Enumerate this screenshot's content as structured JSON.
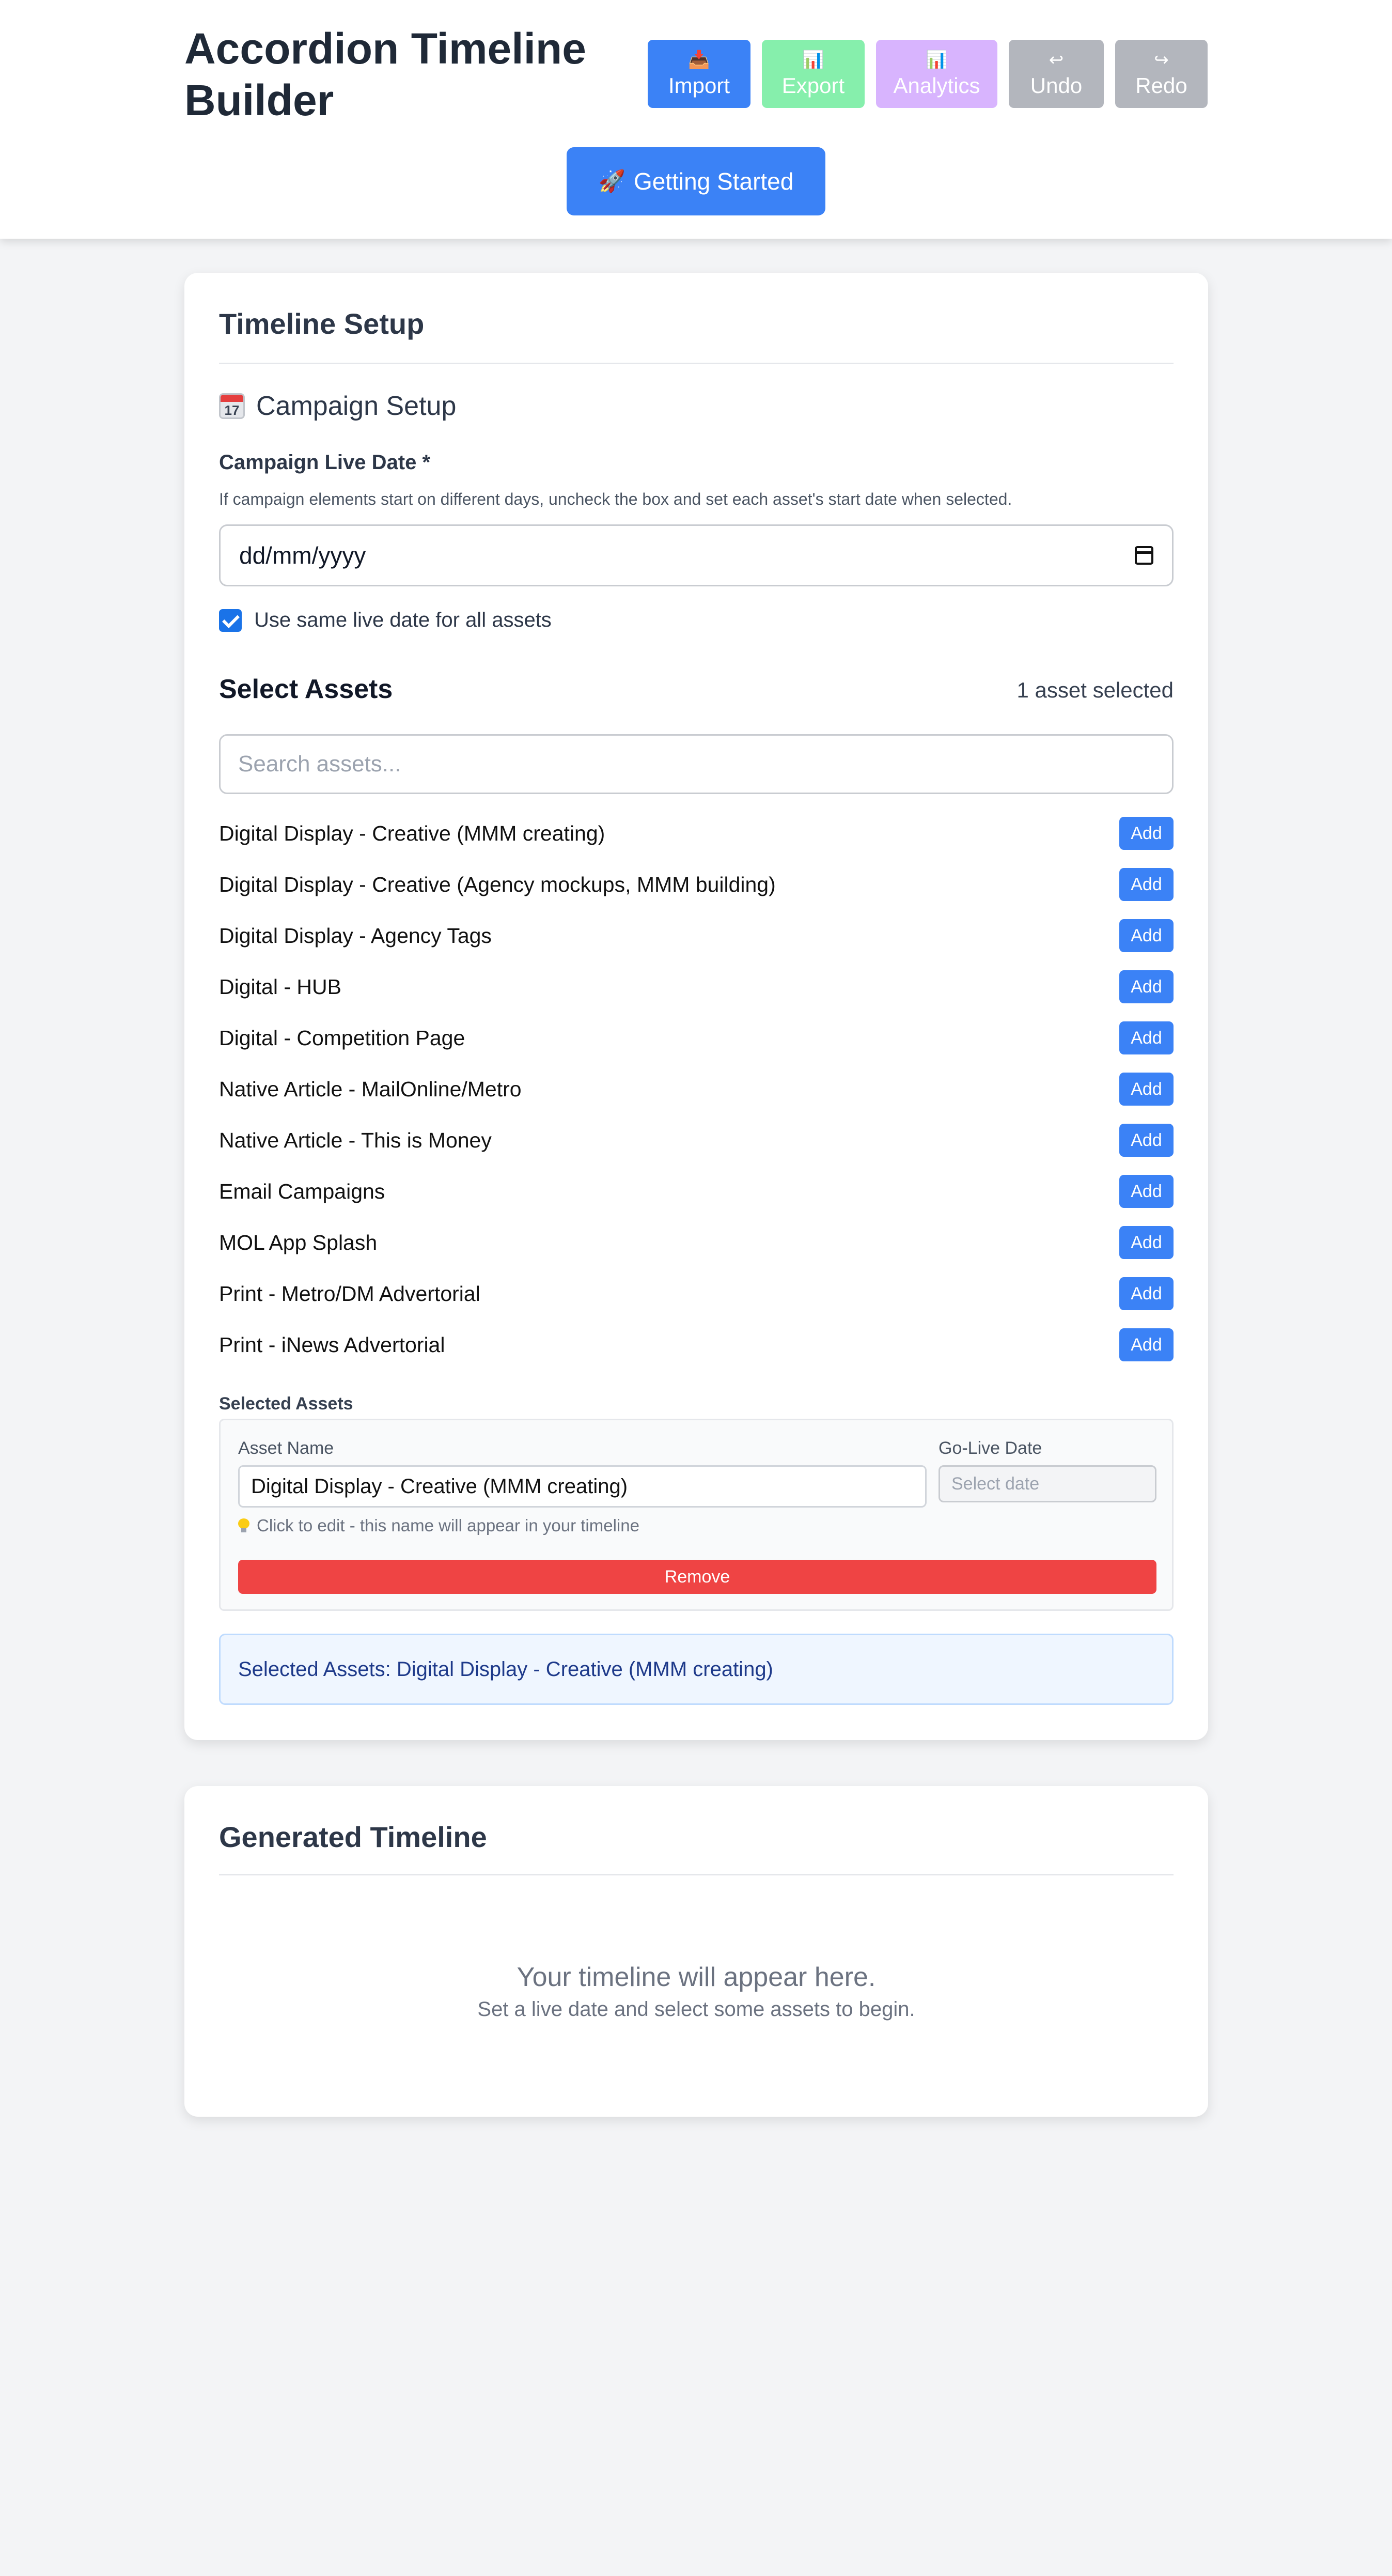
{
  "header": {
    "title": "Accordion Timeline Builder",
    "toolbar": {
      "import": {
        "icon": "inbox-tray-icon",
        "label": "Import"
      },
      "export": {
        "icon": "bar-chart-icon",
        "label": "Export"
      },
      "analytics": {
        "icon": "bar-chart-icon",
        "label": "Analytics"
      },
      "undo": {
        "icon": "undo-arrow-icon",
        "label": "Undo"
      },
      "redo": {
        "icon": "redo-arrow-icon",
        "label": "Redo"
      }
    },
    "getting_started": {
      "icon": "rocket-icon",
      "label": "Getting Started"
    }
  },
  "setup": {
    "card_title": "Timeline Setup",
    "section_icon": "calendar-icon",
    "section_icon_text": "17",
    "section_title": "Campaign Setup",
    "live_date_label": "Campaign Live Date *",
    "live_date_help": "If campaign elements start on different days, uncheck the box and set each asset's start date when selected.",
    "live_date_value": "dd/mm/yyyy",
    "same_date_checkbox": {
      "checked": true,
      "label": "Use same live date for all assets"
    },
    "assets_heading": "Select Assets",
    "assets_count": "1 asset selected",
    "search_placeholder": "Search assets...",
    "add_label": "Add",
    "assets": [
      "Digital Display - Creative (MMM creating)",
      "Digital Display - Creative (Agency mockups, MMM building)",
      "Digital Display - Agency Tags",
      "Digital - HUB",
      "Digital - Competition Page",
      "Native Article - MailOnline/Metro",
      "Native Article - This is Money",
      "Email Campaigns",
      "MOL App Splash",
      "Print - Metro/DM Advertorial",
      "Print - iNews Advertorial"
    ],
    "selected": {
      "heading": "Selected Assets",
      "name_label": "Asset Name",
      "name_value": "Digital Display - Creative (MMM creating)",
      "date_label": "Go-Live Date",
      "date_placeholder": "Select date",
      "hint_icon": "lightbulb-icon",
      "hint": "Click to edit - this name will appear in your timeline",
      "remove_label": "Remove"
    },
    "summary": "Selected Assets: Digital Display - Creative (MMM creating)"
  },
  "timeline": {
    "card_title": "Generated Timeline",
    "empty_title": "Your timeline will appear here.",
    "empty_subtitle": "Set a live date and select some assets to begin."
  },
  "colors": {
    "primary": "#3b82f6",
    "export": "#86efac",
    "analytics": "#d8b4fe",
    "neutral_button": "#b3b6bd",
    "danger": "#ef4444",
    "summary_bg": "#eff6ff",
    "summary_text": "#1e3a8a"
  }
}
